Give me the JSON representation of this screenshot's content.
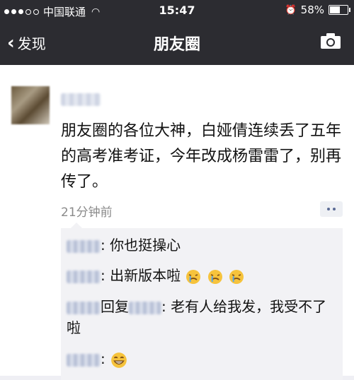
{
  "status_bar": {
    "carrier": "中国联通",
    "time": "15:47",
    "battery": "58%",
    "battery_level": 0.58
  },
  "nav": {
    "back_label": "发现",
    "title": "朋友圈"
  },
  "post": {
    "text": "朋友圈的各位大神，白娅倩连续丢了五年的高考准考证，今年改成杨雷雷了，别再传了。",
    "time": "21分钟前"
  },
  "comments": {
    "c1": {
      "text": "你也挺操心"
    },
    "c2": {
      "text": "出新版本啦"
    },
    "c3": {
      "reply_word": "回复",
      "text": "老有人给我发，我受不了啦"
    }
  },
  "icons": {
    "back": "chevron-left-icon",
    "camera": "camera-icon",
    "wifi": "wifi-icon",
    "alarm": "alarm-icon",
    "emoji_sob": "crying-face-emoji",
    "emoji_grin": "grinning-face-emoji"
  },
  "colors": {
    "nav_bg": "#2c2c31",
    "link_name": "#5b6b95",
    "time_gray": "#8a8a8a",
    "comment_bg": "#f2f2f5"
  }
}
